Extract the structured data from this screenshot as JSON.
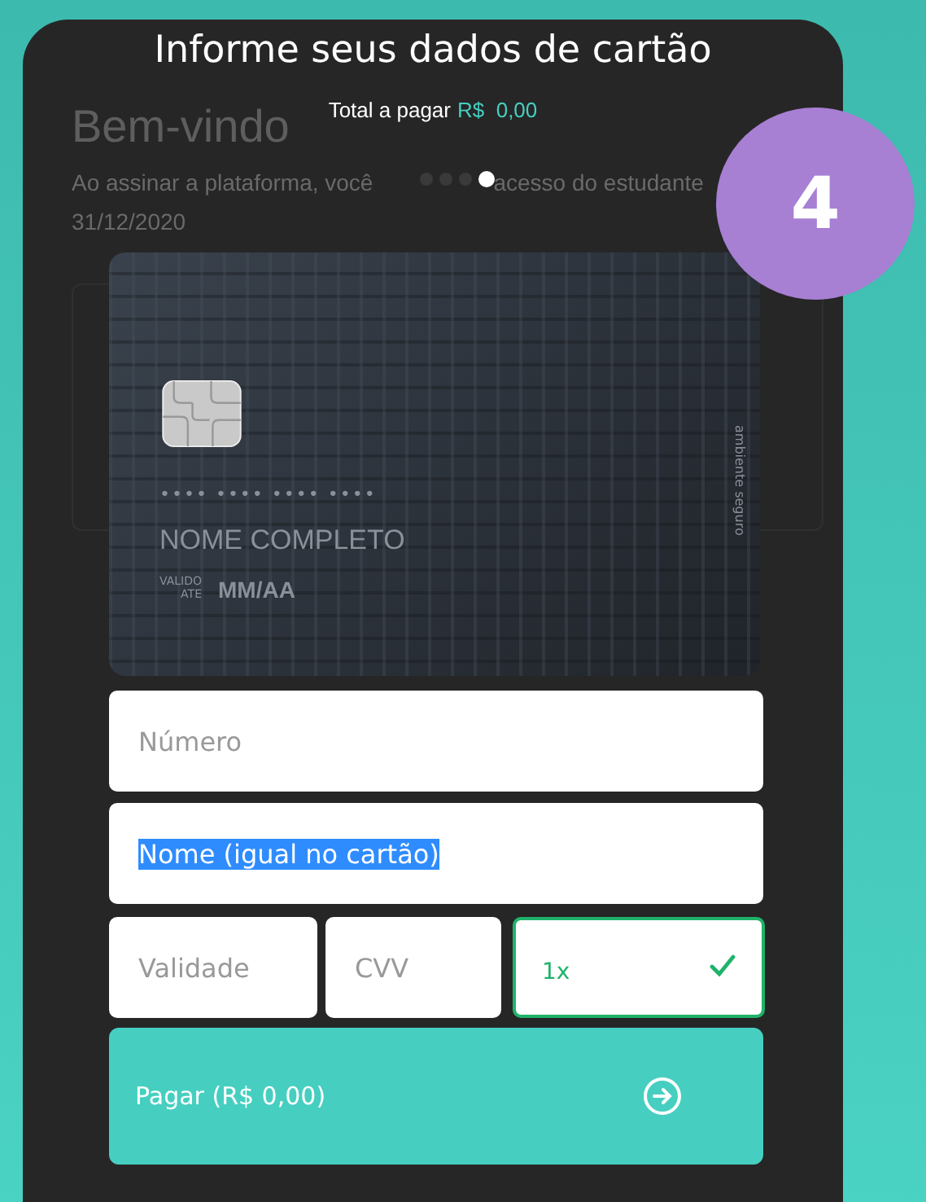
{
  "background_page": {
    "title": "Bem-vindo",
    "text": "Ao assinar a plataforma, você",
    "text_end": "acesso do estudante",
    "date": "31/12/2020"
  },
  "step_badge": "4",
  "modal": {
    "title": "Informe seus dados de cartão",
    "total_label": "Total a pagar",
    "total_currency": "R$",
    "total_value": "0,00",
    "steps": [
      {
        "selected": false
      },
      {
        "selected": false
      },
      {
        "selected": false
      },
      {
        "selected": true
      }
    ],
    "card": {
      "number_mask": "•••• •••• •••• ••••",
      "holder": "NOME COMPLETO",
      "valid_label_top": "VALIDO",
      "valid_label_bottom": "ATE",
      "expiry": "MM/AA",
      "side_text": "ambiente seguro"
    },
    "number_field": {
      "placeholder": "Número"
    },
    "name_field": {
      "value": "Nome (igual no cartão)",
      "text_selected": true
    },
    "expiry_field": {
      "placeholder": "Validade"
    },
    "cvv_field": {
      "placeholder": "CVV"
    },
    "installments": {
      "value": "1x",
      "valid": true
    },
    "pay_button": {
      "label": "Pagar (R$  0,00)"
    }
  }
}
